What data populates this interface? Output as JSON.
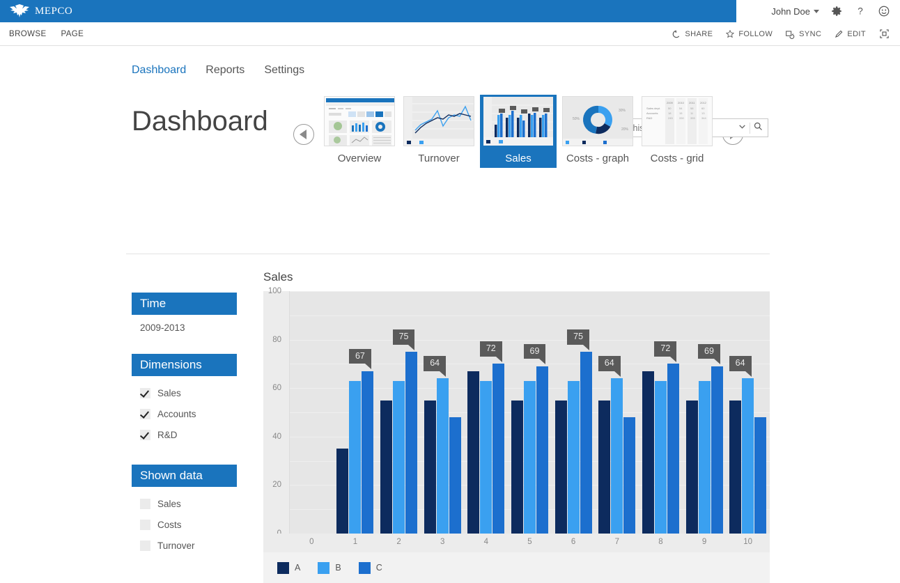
{
  "suite": {
    "brand": "MEPCO",
    "brand_logo_icon": "eagle-logo-icon",
    "user": "John Doe",
    "settings_icon": "gear-icon",
    "help_icon": "question-mark-icon",
    "feedback_icon": "smiley-face-icon",
    "accent": "#1a74bd"
  },
  "ribbon": {
    "tabs": [
      {
        "label": "BROWSE"
      },
      {
        "label": "PAGE"
      }
    ],
    "actions": [
      {
        "label": "SHARE",
        "icon": "share-icon"
      },
      {
        "label": "FOLLOW",
        "icon": "star-icon"
      },
      {
        "label": "SYNC",
        "icon": "sync-icon"
      },
      {
        "label": "EDIT",
        "icon": "pencil-icon"
      },
      {
        "label": "",
        "icon": "focus-on-content-icon"
      }
    ]
  },
  "site_nav": [
    {
      "label": "Dashboard",
      "active": true
    },
    {
      "label": "Reports",
      "active": false
    },
    {
      "label": "Settings",
      "active": false
    }
  ],
  "search": {
    "placeholder": "Search this site...",
    "value": "",
    "dropdown_icon": "chevron-down-icon",
    "search_icon": "magnifier-icon"
  },
  "page": {
    "title": "Dashboard"
  },
  "carousel": {
    "prev_icon": "arrow-left-icon",
    "next_icon": "arrow-right-icon",
    "items": [
      {
        "label": "Overview",
        "selected": false,
        "preview": "dashboard-overview"
      },
      {
        "label": "Turnover",
        "selected": false,
        "preview": "line-chart"
      },
      {
        "label": "Sales",
        "selected": true,
        "preview": "bar-chart"
      },
      {
        "label": "Costs - graph",
        "selected": false,
        "preview": "donut-chart"
      },
      {
        "label": "Costs - grid",
        "selected": false,
        "preview": "data-grid"
      }
    ]
  },
  "filters": [
    {
      "title": "Time",
      "type": "value",
      "value": "2009-2013"
    },
    {
      "title": "Dimensions",
      "type": "checkbox",
      "options": [
        {
          "label": "Sales",
          "checked": true
        },
        {
          "label": "Accounts",
          "checked": true
        },
        {
          "label": "R&D",
          "checked": true
        }
      ]
    },
    {
      "title": "Shown data",
      "type": "checkbox",
      "options": [
        {
          "label": "Sales",
          "checked": false
        },
        {
          "label": "Costs",
          "checked": false
        },
        {
          "label": "Turnover",
          "checked": false
        }
      ]
    }
  ],
  "chart_data": {
    "type": "bar",
    "title": "Sales",
    "xlabel": "",
    "ylabel": "",
    "ylim": [
      0,
      100
    ],
    "yticks": [
      0,
      20,
      40,
      60,
      80,
      100
    ],
    "gridlines": [
      0,
      10,
      20,
      30,
      40,
      50,
      60,
      70,
      80,
      90,
      100
    ],
    "grid": true,
    "legend_position": "bottom-left",
    "categories": [
      "0",
      "1",
      "2",
      "3",
      "4",
      "5",
      "6",
      "7",
      "8",
      "9",
      "10"
    ],
    "series": [
      {
        "name": "A",
        "color": "#0d2b5e",
        "values": [
          null,
          35,
          55,
          55,
          67,
          55,
          55,
          55,
          67,
          55,
          55
        ]
      },
      {
        "name": "B",
        "color": "#3aa0f0",
        "values": [
          null,
          63,
          63,
          64,
          63,
          63,
          63,
          64,
          63,
          63,
          64
        ]
      },
      {
        "name": "C",
        "color": "#1c6fce",
        "values": [
          null,
          67,
          75,
          48,
          70,
          69,
          75,
          48,
          70,
          69,
          48
        ]
      }
    ],
    "annotations": [
      {
        "category": "1",
        "series": "C",
        "value": 67,
        "label": "67"
      },
      {
        "category": "2",
        "series": "C",
        "value": 75,
        "label": "75"
      },
      {
        "category": "3",
        "series": "B",
        "value": 64,
        "label": "64"
      },
      {
        "category": "4",
        "series": "C",
        "value": 70,
        "label": "72"
      },
      {
        "category": "5",
        "series": "C",
        "value": 69,
        "label": "69"
      },
      {
        "category": "6",
        "series": "C",
        "value": 75,
        "label": "75"
      },
      {
        "category": "7",
        "series": "B",
        "value": 64,
        "label": "64"
      },
      {
        "category": "8",
        "series": "C",
        "value": 70,
        "label": "72"
      },
      {
        "category": "9",
        "series": "C",
        "value": 69,
        "label": "69"
      },
      {
        "category": "10",
        "series": "B",
        "value": 64,
        "label": "64"
      }
    ]
  }
}
